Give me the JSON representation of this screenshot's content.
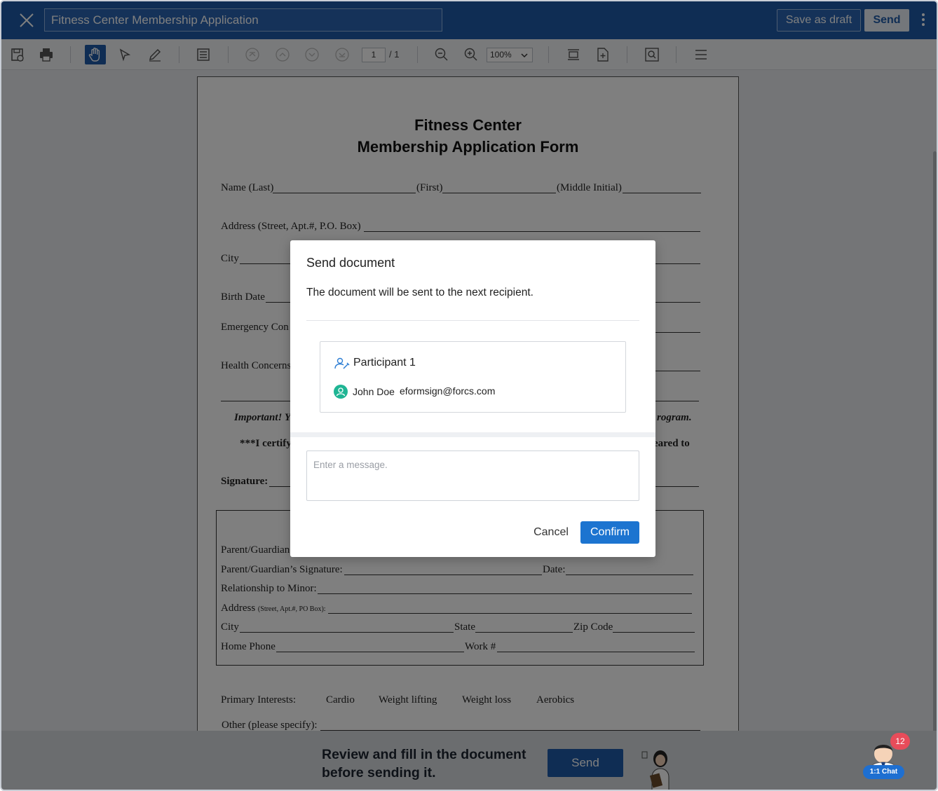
{
  "header": {
    "document_title": "Fitness Center Membership Application",
    "save_draft_label": "Save as draft",
    "send_label": "Send"
  },
  "toolbar": {
    "page_current": "1",
    "page_total": "/ 1",
    "zoom": "100%",
    "icons": [
      "save-icon",
      "print-icon",
      "hand-tool-icon",
      "select-tool-icon",
      "pen-tool-icon",
      "form-icon",
      "first-page-icon",
      "prev-page-icon",
      "next-page-icon",
      "last-page-icon",
      "zoom-out-icon",
      "zoom-in-icon",
      "fit-width-icon",
      "add-page-icon",
      "search-icon",
      "menu-icon"
    ]
  },
  "document": {
    "title_line1": "Fitness Center",
    "title_line2": "Membership Application Form",
    "name_last": "Name (Last)",
    "name_first": "(First)",
    "name_middle": "(Middle Initial)",
    "address": "Address (Street, Apt.#, P.O. Box)",
    "city": "City",
    "birth_date": "Birth Date",
    "emergency": "Emergency Con",
    "health": "Health Concerns",
    "important": "Important! Y",
    "important_end": "rogram.",
    "certify": "***I certify",
    "certify_end": "eared to",
    "signature": "Signature:",
    "guardian_name": "Parent/Guardian",
    "guardian_sig": "Parent/Guardian’s Signature:",
    "date": "Date:",
    "relationship": "Relationship to Minor:",
    "address_label": "Address ",
    "address_small": "(Street, Apt.#, PO Box):",
    "city2": "City",
    "state": "State",
    "zip": "Zip Code",
    "home_phone": "Home Phone",
    "work": "Work #",
    "primary_interests": "Primary Interests:",
    "interests": [
      "Cardio",
      "Weight lifting",
      "Weight loss",
      "Aerobics"
    ],
    "other": "Other (please specify):"
  },
  "modal": {
    "title": "Send document",
    "description": "The document will be sent to the next recipient.",
    "participant_label": "Participant 1",
    "recipient_name": "John Doe",
    "recipient_email": "eformsign@forcs.com",
    "message_placeholder": "Enter a message.",
    "cancel_label": "Cancel",
    "confirm_label": "Confirm"
  },
  "bottom_bar": {
    "prompt_line1": "Review and fill in the document",
    "prompt_line2": "before sending it.",
    "send_label": "Send"
  },
  "chat": {
    "badge_count": "12",
    "label": "1:1 Chat"
  },
  "colors": {
    "header_blue": "#1e5aa8",
    "confirm_blue": "#1c74d0",
    "avatar_teal": "#1fb594",
    "badge_red": "#e84c5a"
  }
}
